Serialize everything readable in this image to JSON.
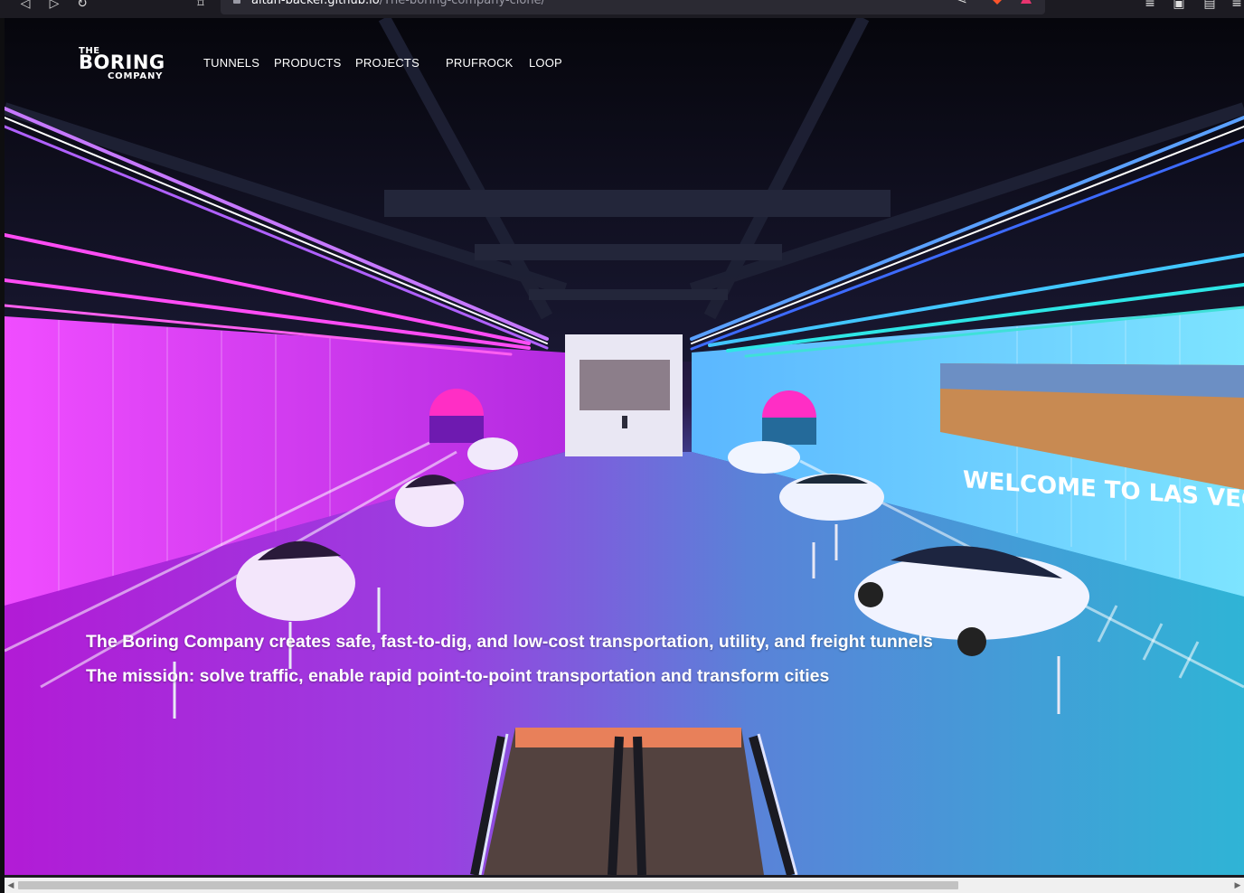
{
  "browser": {
    "url_host": "altan-backer.github.io",
    "url_path": "/The-boring-company-clone/"
  },
  "logo": {
    "line1": "THE",
    "line2": "BORING",
    "line3": "COMPANY"
  },
  "nav": {
    "items": [
      {
        "label": "TUNNELS"
      },
      {
        "label": "PRODUCTS"
      },
      {
        "label": "PROJECTS"
      },
      {
        "label": "PRUFROCK"
      },
      {
        "label": "LOOP"
      }
    ]
  },
  "hero": {
    "line1": "The Boring Company creates safe, fast-to-dig, and low-cost transportation, utility, and freight tunnels",
    "line2": "The mission: solve traffic, enable rapid point-to-point transportation and transform cities",
    "billboard_text": "WELCOME TO LAS VEG"
  },
  "colors": {
    "neon_pink": "#e040fb",
    "neon_blue": "#3d8bff",
    "neon_cyan": "#2ee6e6",
    "text": "#ffffff"
  }
}
